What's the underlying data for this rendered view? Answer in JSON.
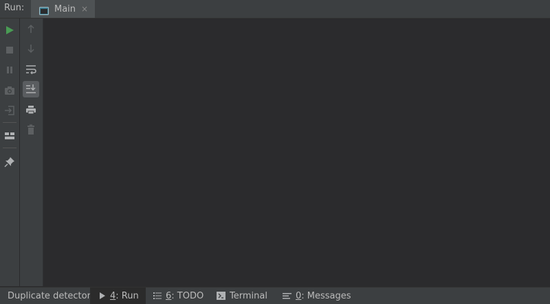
{
  "header": {
    "run_label": "Run:",
    "tab": {
      "label": "Main",
      "close": "×",
      "icon": "console-window-icon"
    }
  },
  "left_toolbar": [
    {
      "icon": "run-icon",
      "enabled": true
    },
    {
      "icon": "stop-icon",
      "enabled": false
    },
    {
      "icon": "pause-icon",
      "enabled": false
    },
    {
      "icon": "camera-icon",
      "enabled": false
    },
    {
      "icon": "exit-icon",
      "enabled": false
    },
    {
      "icon": "layout-icon",
      "enabled": true
    },
    {
      "icon": "pin-icon",
      "enabled": true
    }
  ],
  "second_toolbar": [
    {
      "icon": "arrow-up-icon",
      "enabled": false
    },
    {
      "icon": "arrow-down-icon",
      "enabled": false
    },
    {
      "icon": "soft-wrap-icon",
      "enabled": true
    },
    {
      "icon": "scroll-to-end-icon",
      "enabled": true,
      "active": true
    },
    {
      "icon": "print-icon",
      "enabled": true
    },
    {
      "icon": "trash-icon",
      "enabled": false
    }
  ],
  "status_bar": {
    "duplicate_detector": "Duplicate detector",
    "run": {
      "mnemonic": "4",
      "rest": ": Run"
    },
    "todo": {
      "mnemonic": "6",
      "rest": ": TODO"
    },
    "terminal": "Terminal",
    "messages": {
      "mnemonic": "0",
      "rest": ": Messages"
    }
  },
  "colors": {
    "background": "#2b2b2d",
    "panel": "#3c3f41",
    "run_green": "#499c54",
    "icon_enabled": "#afb1b3",
    "icon_disabled": "#5d6062"
  }
}
